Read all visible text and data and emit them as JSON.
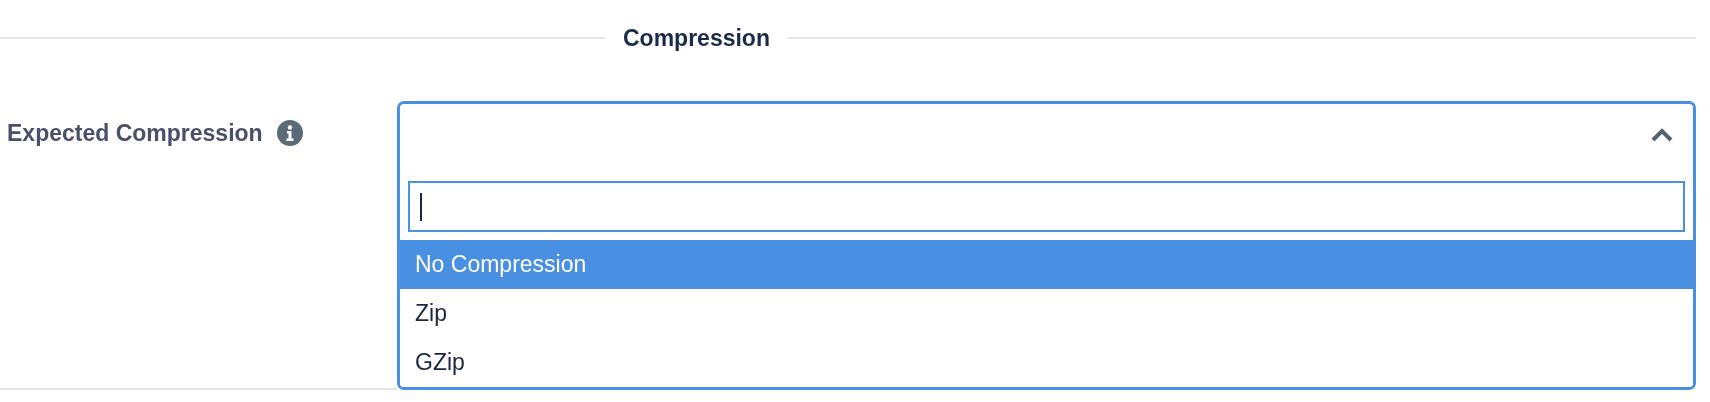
{
  "section": {
    "title": "Compression"
  },
  "field": {
    "label": "Expected Compression",
    "expanded": true,
    "options": [
      {
        "label": "No Compression",
        "selected": true
      },
      {
        "label": "Zip",
        "selected": false
      },
      {
        "label": "GZip",
        "selected": false
      }
    ]
  }
}
